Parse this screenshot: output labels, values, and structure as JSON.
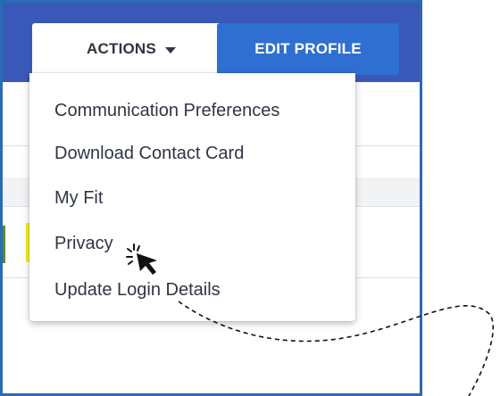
{
  "header": {
    "actions_label": "ACTIONS",
    "edit_profile_label": "EDIT PROFILE"
  },
  "actions_menu": {
    "items": [
      "Communication Preferences",
      "Download Contact Card",
      "My Fit",
      "Privacy",
      "Update Login Details"
    ],
    "highlighted_item": "Privacy"
  },
  "icons": {
    "caret": "caret-down-icon",
    "cursor": "mouse-pointer-icon"
  },
  "colors": {
    "header_band": "#3a58b8",
    "edit_button": "#2e6fd1",
    "highlight": "#f1f01f",
    "frame_border": "#2a6bb5"
  }
}
